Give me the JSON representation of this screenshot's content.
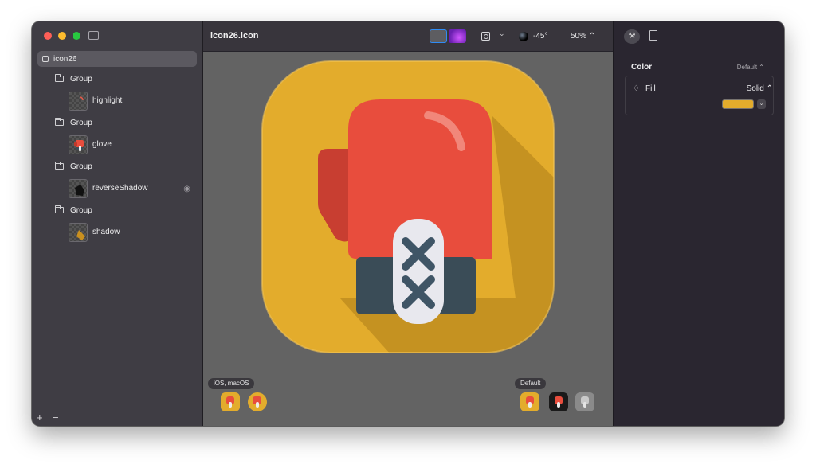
{
  "window": {
    "document_title": "icon26.icon"
  },
  "sidebar": {
    "root": {
      "label": "icon26"
    },
    "items": [
      {
        "group_label": "Group",
        "layer_label": "highlight"
      },
      {
        "group_label": "Group",
        "layer_label": "glove"
      },
      {
        "group_label": "Group",
        "layer_label": "reverseShadow"
      },
      {
        "group_label": "Group",
        "layer_label": "shadow"
      }
    ],
    "add_label": "+",
    "remove_label": "−"
  },
  "toolbar": {
    "light_angle": "-45°",
    "zoom": "50% ⌃"
  },
  "canvas": {
    "platform_chip": "iOS, macOS",
    "appearance_chip": "Default"
  },
  "inspector": {
    "section_title": "Color",
    "section_mode": "Default ⌃",
    "fill_label": "Fill",
    "fill_type": "Solid ⌃",
    "fill_color": "#e3ac2c"
  },
  "colors": {
    "background": "#e3ac2c",
    "glove": "#e84d3d",
    "cuff": "#3a4c57",
    "lace_panel": "#e8e8ee",
    "accent": "#2f8cf5"
  }
}
